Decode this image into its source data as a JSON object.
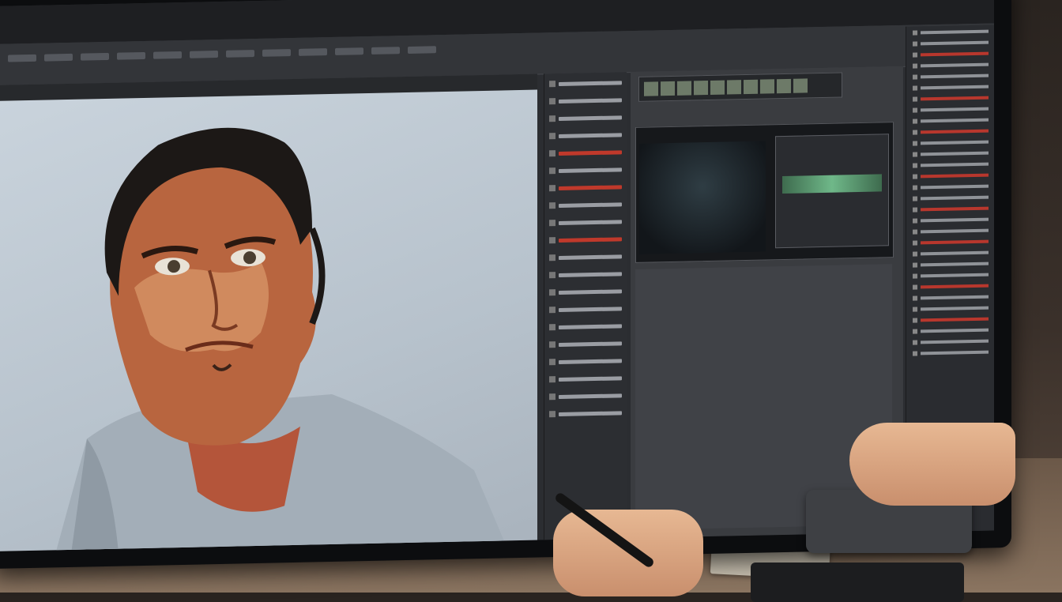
{
  "app": {
    "menu": [],
    "document_tabs": []
  },
  "colors": {
    "accent_red": "#c0392b",
    "ui_dark": "#2b2d31",
    "canvas_bg": "#c9d3dc"
  },
  "icons": [
    "layer-visibility-icon",
    "timeline-thumbnail-icon",
    "tool-icon"
  ]
}
